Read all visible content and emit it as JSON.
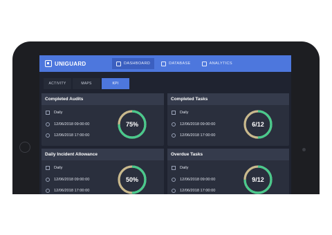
{
  "app": {
    "logo_text": "UNIGUARD"
  },
  "nav": [
    {
      "label": "DASHBOARD",
      "icon": "dashboard-icon",
      "active": true
    },
    {
      "label": "DATABASE",
      "icon": "database-icon",
      "active": false
    },
    {
      "label": "ANALYTICS",
      "icon": "analytics-icon",
      "active": false
    }
  ],
  "tabs": [
    {
      "label": "ACTIVITY",
      "active": false
    },
    {
      "label": "MAPS",
      "active": false
    },
    {
      "label": "KPI",
      "active": true
    }
  ],
  "cards": [
    {
      "title": "Completed Audits",
      "frequency": "Daily",
      "start": "12/06/2018 09:00:00",
      "end": "12/06/2018 17:00:00",
      "display": "75%",
      "progress": 0.75
    },
    {
      "title": "Completed Tasks",
      "frequency": "Daily",
      "start": "12/06/2018 09:00:00",
      "end": "12/06/2018 17:00:00",
      "display": "6/12",
      "progress": 0.5
    },
    {
      "title": "Daily Incident Allowance",
      "frequency": "Daily",
      "start": "12/06/2018 09:00:00",
      "end": "12/06/2018 17:00:00",
      "display": "50%",
      "progress": 0.5
    },
    {
      "title": "Overdue Tasks",
      "frequency": "Daily",
      "start": "12/06/2018 09:00:00",
      "end": "12/06/2018 17:00:00",
      "display": "9/12",
      "progress": 0.75
    }
  ],
  "colors": {
    "accent": "#4d77dd",
    "ring_fill": "#49c98c",
    "ring_track": "#c9b98d"
  }
}
